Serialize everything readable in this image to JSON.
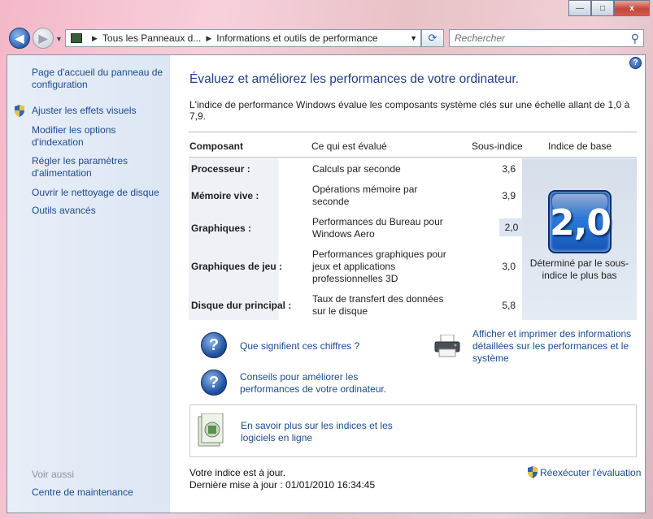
{
  "window": {
    "minimize": "—",
    "maximize": "□",
    "close": "x"
  },
  "address": {
    "crumb1": "Tous les Panneaux d...",
    "crumb2": "Informations et outils de performance",
    "search_placeholder": "Rechercher"
  },
  "sidebar": {
    "home": "Page d'accueil du panneau de configuration",
    "items": [
      {
        "label": "Ajuster les effets visuels",
        "shield": true
      },
      {
        "label": "Modifier les options d'indexation",
        "shield": false
      },
      {
        "label": "Régler les paramètres d'alimentation",
        "shield": false
      },
      {
        "label": "Ouvrir le nettoyage de disque",
        "shield": false
      },
      {
        "label": "Outils avancés",
        "shield": false
      }
    ],
    "see_also": "Voir aussi",
    "maintenance": "Centre de maintenance"
  },
  "main": {
    "title": "Évaluez et améliorez les performances de votre ordinateur.",
    "description": "L'indice de performance Windows évalue les composants système clés sur une échelle allant de 1,0 à 7,9.",
    "table": {
      "headers": [
        "Composant",
        "Ce qui est évalué",
        "Sous-indice",
        "Indice de base"
      ],
      "rows": [
        {
          "component": "Processeur :",
          "evaluated": "Calculs par seconde",
          "score": "3,6"
        },
        {
          "component": "Mémoire vive :",
          "evaluated": "Opérations mémoire par seconde",
          "score": "3,9"
        },
        {
          "component": "Graphiques :",
          "evaluated": "Performances du Bureau pour Windows Aero",
          "score": "2,0"
        },
        {
          "component": "Graphiques de jeu :",
          "evaluated": "Performances graphiques pour jeux et applications professionnelles 3D",
          "score": "3,0"
        },
        {
          "component": "Disque dur principal :",
          "evaluated": "Taux de transfert des données sur le disque",
          "score": "5,8"
        }
      ],
      "base_score": "2,0",
      "base_text": "Déterminé par le sous-indice le plus bas"
    },
    "links": {
      "what_numbers": "Que signifient ces chiffres ?",
      "tips": "Conseils pour améliorer les performances de votre ordinateur.",
      "print": "Afficher et imprimer des informations détaillées sur les performances et le système",
      "learn_more": "En savoir plus sur les indices et les logiciels en ligne"
    },
    "status": "Votre indice est à jour.",
    "last_update": "Dernière mise à jour : 01/01/2010 16:34:45",
    "rerun": "Réexécuter l'évaluation"
  },
  "colors": {
    "link": "#1b4a8f",
    "title": "#1f3f8a",
    "badge": "#1556b6"
  }
}
